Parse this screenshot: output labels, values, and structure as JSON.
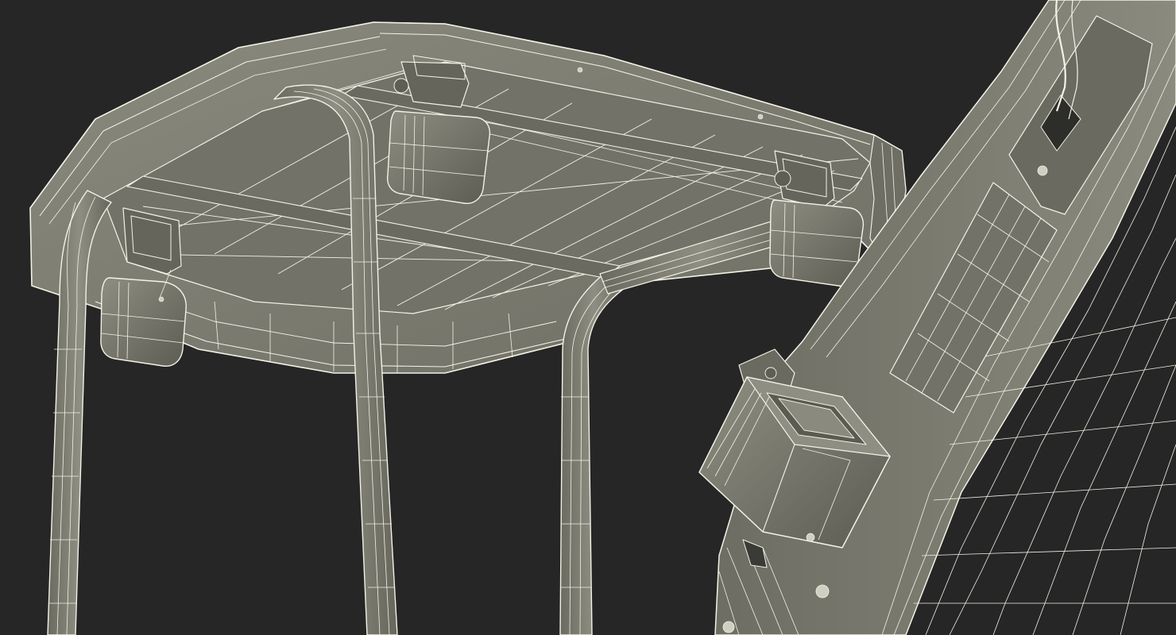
{
  "scene": {
    "subject": "wireframe-render-cab-roof-with-work-lights-and-boom-arm",
    "colors": {
      "background": "#262626",
      "surface": "#77776c",
      "surface_light": "#8c8c80",
      "surface_dark": "#5f5f56",
      "wire": "#f2f2e6"
    }
  }
}
